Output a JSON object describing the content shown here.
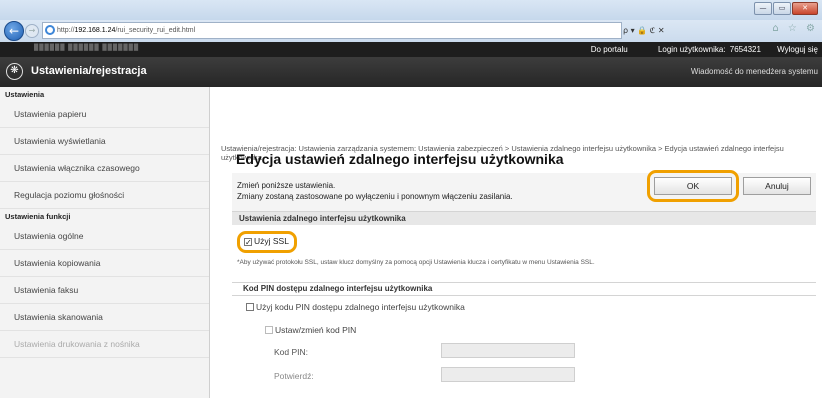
{
  "browser": {
    "url_prefix": "http://",
    "url_host": "192.168.1.24",
    "url_path": "/rui_security_rui_edit.html",
    "address_tools": "ρ ▾ 🔒 ℭ ✕",
    "toolbar_icons": "⌂ ☆ ⚙",
    "window_buttons": [
      "—",
      "▭",
      "✕"
    ]
  },
  "portal": {
    "device_id": "██████ ██████ ███████",
    "portal_link": "Do portalu",
    "login_label": "Login użytkownika:",
    "login_value": "7654321",
    "logout": "Wyloguj się"
  },
  "header": {
    "title": "Ustawienia/rejestracja",
    "admin_message": "Wiadomość do menedżera systemu"
  },
  "sidebar": {
    "settings_heading": "Ustawienia",
    "settings_items": [
      "Ustawienia papieru",
      "Ustawienia wyświetlania",
      "Ustawienia włącznika czasowego",
      "Regulacja poziomu głośności"
    ],
    "functions_heading": "Ustawienia funkcji",
    "function_items": [
      "Ustawienia ogólne",
      "Ustawienia kopiowania",
      "Ustawienia faksu",
      "Ustawienia skanowania",
      "Ustawienia drukowania z nośnika"
    ]
  },
  "main": {
    "breadcrumb": "Ustawienia/rejestracja: Ustawienia zarządzania systemem: Ustawienia zabezpieczeń > Ustawienia zdalnego interfejsu użytkownika > Edycja ustawień zdalnego interfejsu użytkownika",
    "title": "Edycja ustawień zdalnego interfejsu użytkownika",
    "info_line1": "Zmień poniższe ustawienia.",
    "info_line2": "Zmiany zostaną zastosowane po wyłączeniu i ponownym włączeniu zasilania.",
    "ok": "OK",
    "cancel": "Anuluj",
    "section1": "Ustawienia zdalnego interfejsu użytkownika",
    "use_ssl": "Użyj SSL",
    "use_ssl_checked": true,
    "ssl_note": "*Aby używać protokołu SSL, ustaw klucz domyślny za pomocą opcji Ustawienia klucza i certyfikatu w menu Ustawienia SSL.",
    "section2": "Kod PIN dostępu zdalnego interfejsu użytkownika",
    "use_pin": "Użyj kodu PIN dostępu zdalnego interfejsu użytkownika",
    "set_pin": "Ustaw/zmień kod PIN",
    "pin_label": "Kod PIN:",
    "confirm_label": "Potwierdź:"
  }
}
